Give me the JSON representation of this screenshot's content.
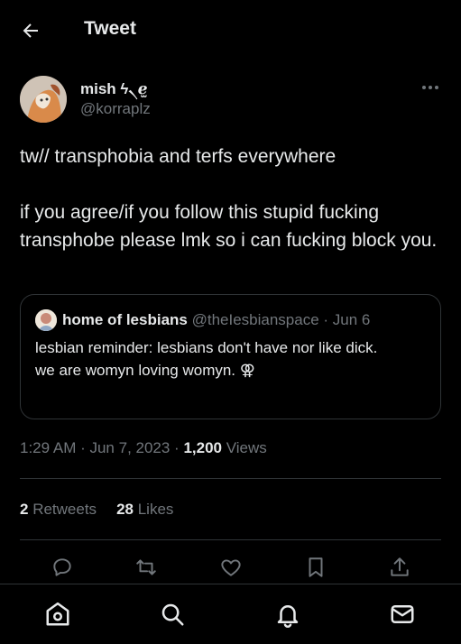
{
  "header": {
    "title": "Tweet",
    "back_icon": "arrow-left-icon"
  },
  "tweet": {
    "author_name": "mish ϟ৲ℯ̫",
    "author_handle": "@korraplz",
    "body": [
      "tw// transphobia and terfs everywhere",
      "if you agree/if you follow this stupid fucking transphobe please lmk so i can fucking block you."
    ],
    "timestamp": "1:29 AM · Jun 7, 2023 · ",
    "views_count": "1,200",
    "views_label": " Views",
    "retweets_count": "2",
    "retweets_label": " Retweets",
    "likes_count": "28",
    "likes_label": " Likes"
  },
  "quote": {
    "name": "home of lesbians",
    "meta": " @theIesbianspace · Jun 6",
    "lines": [
      "lesbian reminder: lesbians don't have nor like dick.",
      "we are womyn loving womyn. ⚢"
    ]
  },
  "actions": [
    "reply-icon",
    "retweet-icon",
    "like-icon",
    "bookmark-icon",
    "share-icon"
  ],
  "bottom_nav": [
    "home-icon",
    "search-icon",
    "notifications-icon",
    "messages-icon"
  ],
  "colors": {
    "background": "#000000",
    "text": "#e7e9ea",
    "muted": "#71767b",
    "border": "#2f3336"
  }
}
